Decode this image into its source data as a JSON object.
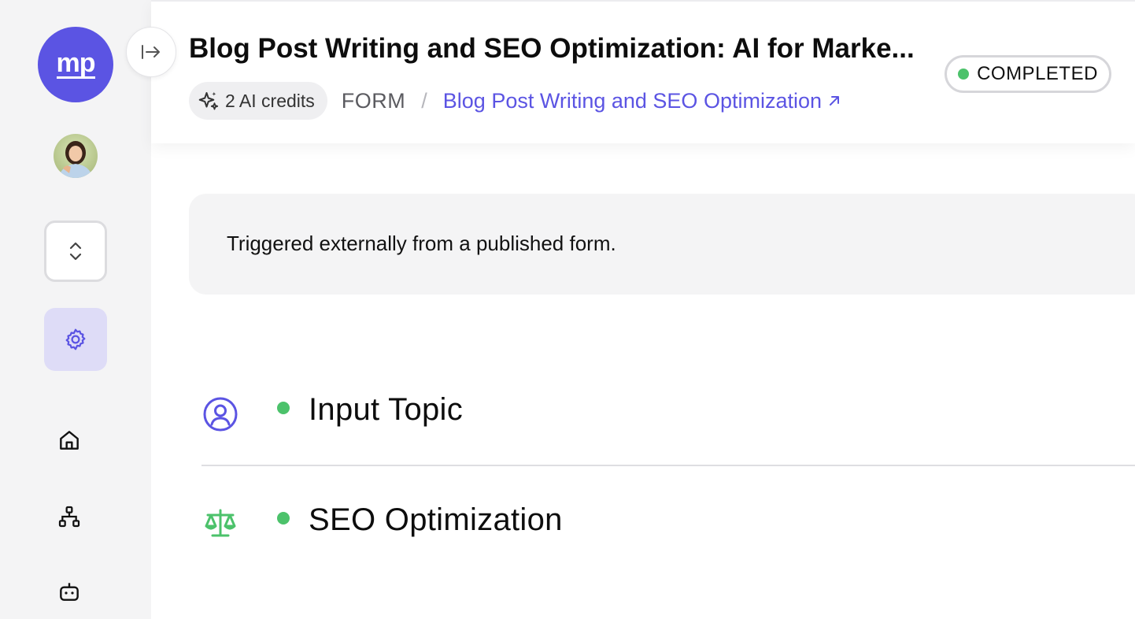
{
  "sidebar": {
    "logo_text": "mp",
    "nav_items": [
      "home-icon",
      "workflow-icon",
      "bot-icon"
    ],
    "active_item": "settings"
  },
  "header": {
    "title": "Blog Post Writing and SEO Optimization: AI for Marke...",
    "credits": "2 AI credits",
    "breadcrumb_type": "FORM",
    "breadcrumb_separator": "/",
    "breadcrumb_link": "Blog Post Writing and SEO Optimization",
    "status": "COMPLETED"
  },
  "trigger": {
    "text": "Triggered externally from a published form."
  },
  "steps": [
    {
      "title": "Input Topic",
      "icon": "user-circle-icon",
      "status_color": "#4cc26b"
    },
    {
      "title": "SEO Optimization",
      "icon": "scale-icon",
      "status_color": "#4cc26b"
    }
  ],
  "colors": {
    "brand": "#5b54e3",
    "success": "#4cc26b",
    "active_bg": "#dedcf7"
  }
}
